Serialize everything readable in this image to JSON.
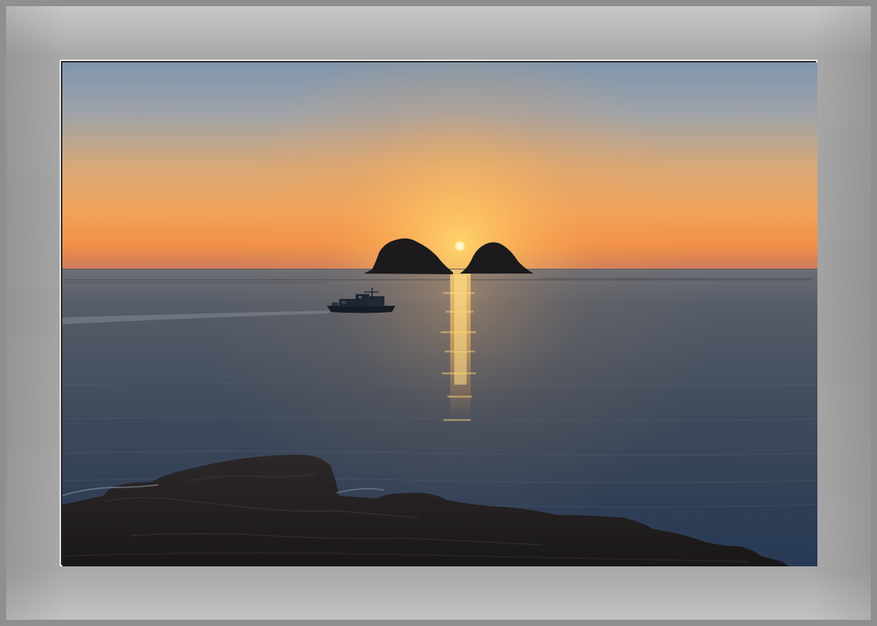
{
  "scene": {
    "subject": "sunset-over-sea",
    "elements": [
      "sun",
      "left-island",
      "right-island",
      "fishing-boat",
      "sun-reflection",
      "rocky-shore"
    ]
  },
  "colors": {
    "sky_top": "#7f96ae",
    "sky_mid": "#e3a463",
    "sky_horizon": "#f3913c",
    "sun": "#fff4c6",
    "sea": "#3f4c5d",
    "sea_deep": "#2a3a52",
    "rocks": "#1f1c1d",
    "frame": "#a4a4a4"
  }
}
